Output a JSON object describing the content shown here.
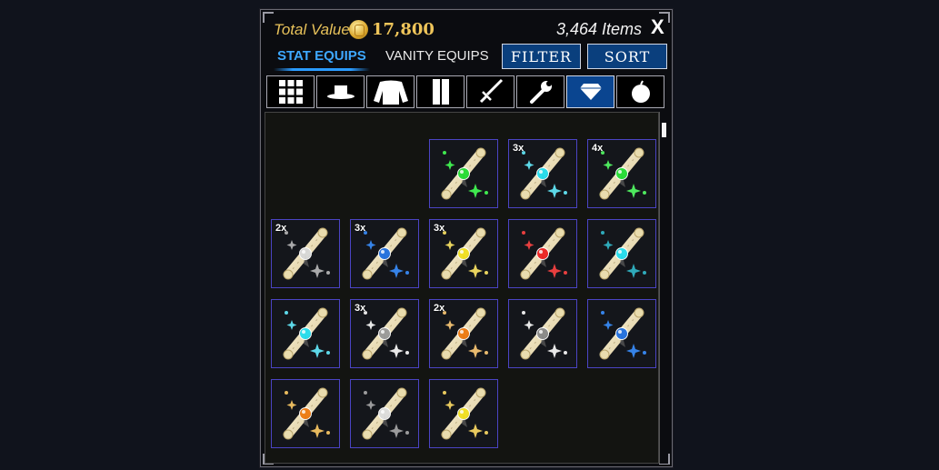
{
  "header": {
    "total_value_label": "Total Value",
    "total_value": "17,800",
    "items_count": "3,464 Items",
    "close_label": "X"
  },
  "tabs": [
    {
      "label": "STAT EQUIPS",
      "active": true
    },
    {
      "label": "VANITY EQUIPS",
      "active": false
    }
  ],
  "buttons": {
    "filter": "FILTER",
    "sort": "SORT"
  },
  "categories": [
    {
      "icon": "grid-icon",
      "active": false
    },
    {
      "icon": "hat-icon",
      "active": false
    },
    {
      "icon": "shirt-icon",
      "active": false
    },
    {
      "icon": "pants-icon",
      "active": false
    },
    {
      "icon": "sword-icon",
      "active": false
    },
    {
      "icon": "wrench-icon",
      "active": false
    },
    {
      "icon": "gem-icon",
      "active": true
    },
    {
      "icon": "fruit-icon",
      "active": false
    }
  ],
  "colors": {
    "accent": "#2a9bff",
    "button_bg": "#0a3f7d",
    "slot_border": "#4b44c4",
    "gold": "#e8c25a"
  },
  "items": [
    {
      "qty": "",
      "gem": "#22dd33",
      "sparkle": "#44ff55"
    },
    {
      "qty": "3x",
      "gem": "#22ddee",
      "sparkle": "#66eeff"
    },
    {
      "qty": "4x",
      "gem": "#22dd33",
      "sparkle": "#55ff66"
    },
    {
      "qty": "2x",
      "gem": "#d8d8d8",
      "sparkle": "#bbbbbb"
    },
    {
      "qty": "3x",
      "gem": "#1f6fe0",
      "sparkle": "#3a8fff"
    },
    {
      "qty": "3x",
      "gem": "#f2e020",
      "sparkle": "#ffe866"
    },
    {
      "qty": "",
      "gem": "#ee2222",
      "sparkle": "#ff4444"
    },
    {
      "qty": "",
      "gem": "#22ddee",
      "sparkle": "#33bbcc"
    },
    {
      "qty": "",
      "gem": "#22ddee",
      "sparkle": "#66eeff"
    },
    {
      "qty": "3x",
      "gem": "#999999",
      "sparkle": "#ffffff"
    },
    {
      "qty": "2x",
      "gem": "#ee7a10",
      "sparkle": "#ffcc77"
    },
    {
      "qty": "",
      "gem": "#888888",
      "sparkle": "#ffffff"
    },
    {
      "qty": "",
      "gem": "#1f6fe0",
      "sparkle": "#3a8fff"
    },
    {
      "qty": "",
      "gem": "#ee7a10",
      "sparkle": "#ffcc66"
    },
    {
      "qty": "",
      "gem": "#dddddd",
      "sparkle": "#aaaaaa"
    },
    {
      "qty": "",
      "gem": "#f2e020",
      "sparkle": "#ffdd66"
    }
  ]
}
